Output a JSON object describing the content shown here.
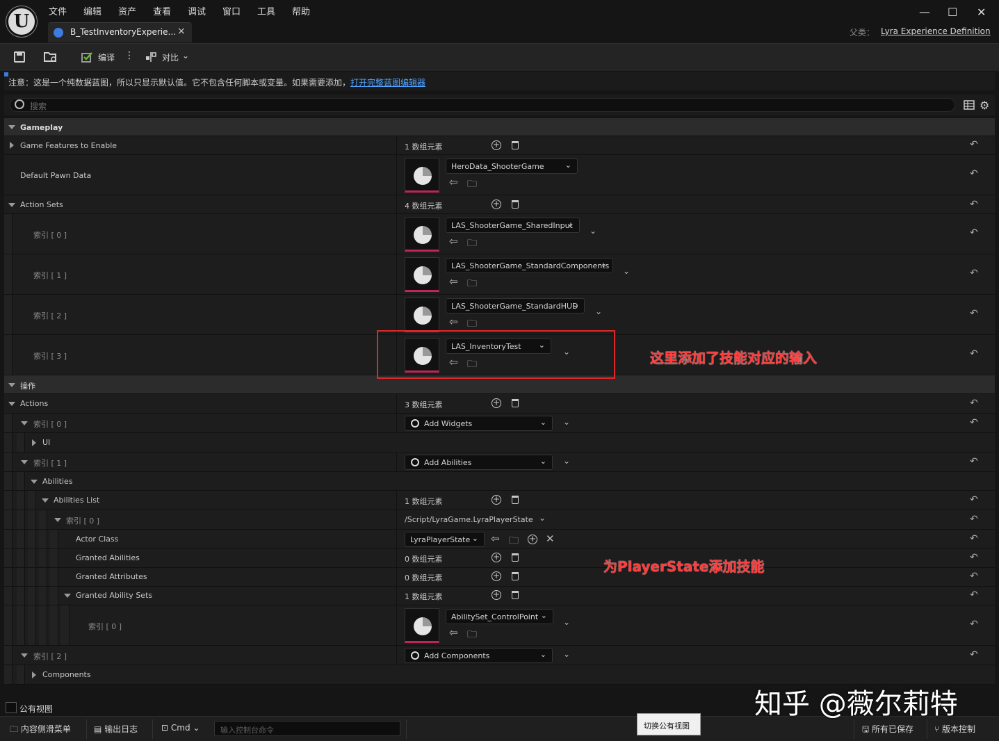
{
  "app": {
    "logo_text": "U"
  },
  "menu": [
    "文件",
    "编辑",
    "资产",
    "查看",
    "调试",
    "窗口",
    "工具",
    "帮助"
  ],
  "tab": {
    "title": "B_TestInventoryExperie...",
    "close": "×"
  },
  "window": {
    "minimize": "—",
    "maximize": "☐",
    "close": "✕"
  },
  "parent": {
    "label": "父类：",
    "value": "Lyra Experience Definition"
  },
  "toolbar": {
    "compile_label": "编译",
    "diff_label": "对比",
    "more": "⋮"
  },
  "notice": {
    "text": "注意：这是一个纯数据蓝图，所以只显示默认值。它不包含任何脚本或变量。如果需要添加，",
    "link": "打开完整蓝图编辑器"
  },
  "search": {
    "placeholder": "搜索"
  },
  "details": {
    "cat_gameplay": "Gameplay",
    "game_features": "Game Features to Enable",
    "game_features_count": "1 数组元素",
    "default_pawn": "Default Pawn Data",
    "pawn_asset": "HeroData_ShooterGame",
    "action_sets": "Action Sets",
    "action_sets_count": "4 数组元素",
    "idx0": "索引 [ 0 ]",
    "idx1": "索引 [ 1 ]",
    "idx2": "索引 [ 2 ]",
    "idx3": "索引 [ 3 ]",
    "as0": "LAS_ShooterGame_SharedInput",
    "as1": "LAS_ShooterGame_StandardComponents",
    "as2": "LAS_ShooterGame_StandardHUD",
    "as3": "LAS_InventoryTest",
    "cat_ops": "操作",
    "actions": "Actions",
    "actions_count": "3 数组元素",
    "add_widgets": "Add Widgets",
    "ui": "UI",
    "add_abilities": "Add Abilities",
    "abilities": "Abilities",
    "abilities_list": "Abilities List",
    "abilities_list_count": "1 数组元素",
    "player_state_path": "/Script/LyraGame.LyraPlayerState",
    "actor_class": "Actor Class",
    "actor_class_value": "LyraPlayerState",
    "granted_abilities": "Granted Abilities",
    "granted_abilities_count": "0 数组元素",
    "granted_attributes": "Granted Attributes",
    "granted_attributes_count": "0 数组元素",
    "granted_sets": "Granted Ability Sets",
    "granted_sets_count": "1 数组元素",
    "ability_set": "AbilitySet_ControlPoint",
    "add_components": "Add Components",
    "components": "Components"
  },
  "annotations": {
    "input_note": "这里添加了技能对应的输入",
    "playerstate_note": "为PlayerState添加技能"
  },
  "public_view": {
    "label": "公有视图"
  },
  "statusbar": {
    "content_drawer": "内容侧滑菜单",
    "output_log": "输出日志",
    "cmd": "Cmd",
    "console_placeholder": "输入控制台命令",
    "tooltip": "切换公有视图",
    "all_saved": "所有已保存",
    "source_control": "版本控制"
  },
  "watermark": "知乎 @薇尔莉特",
  "colors": {
    "accent_link": "#4fa3ff",
    "annotation_red": "#e02828",
    "thumb_bar": "#c0245a"
  }
}
